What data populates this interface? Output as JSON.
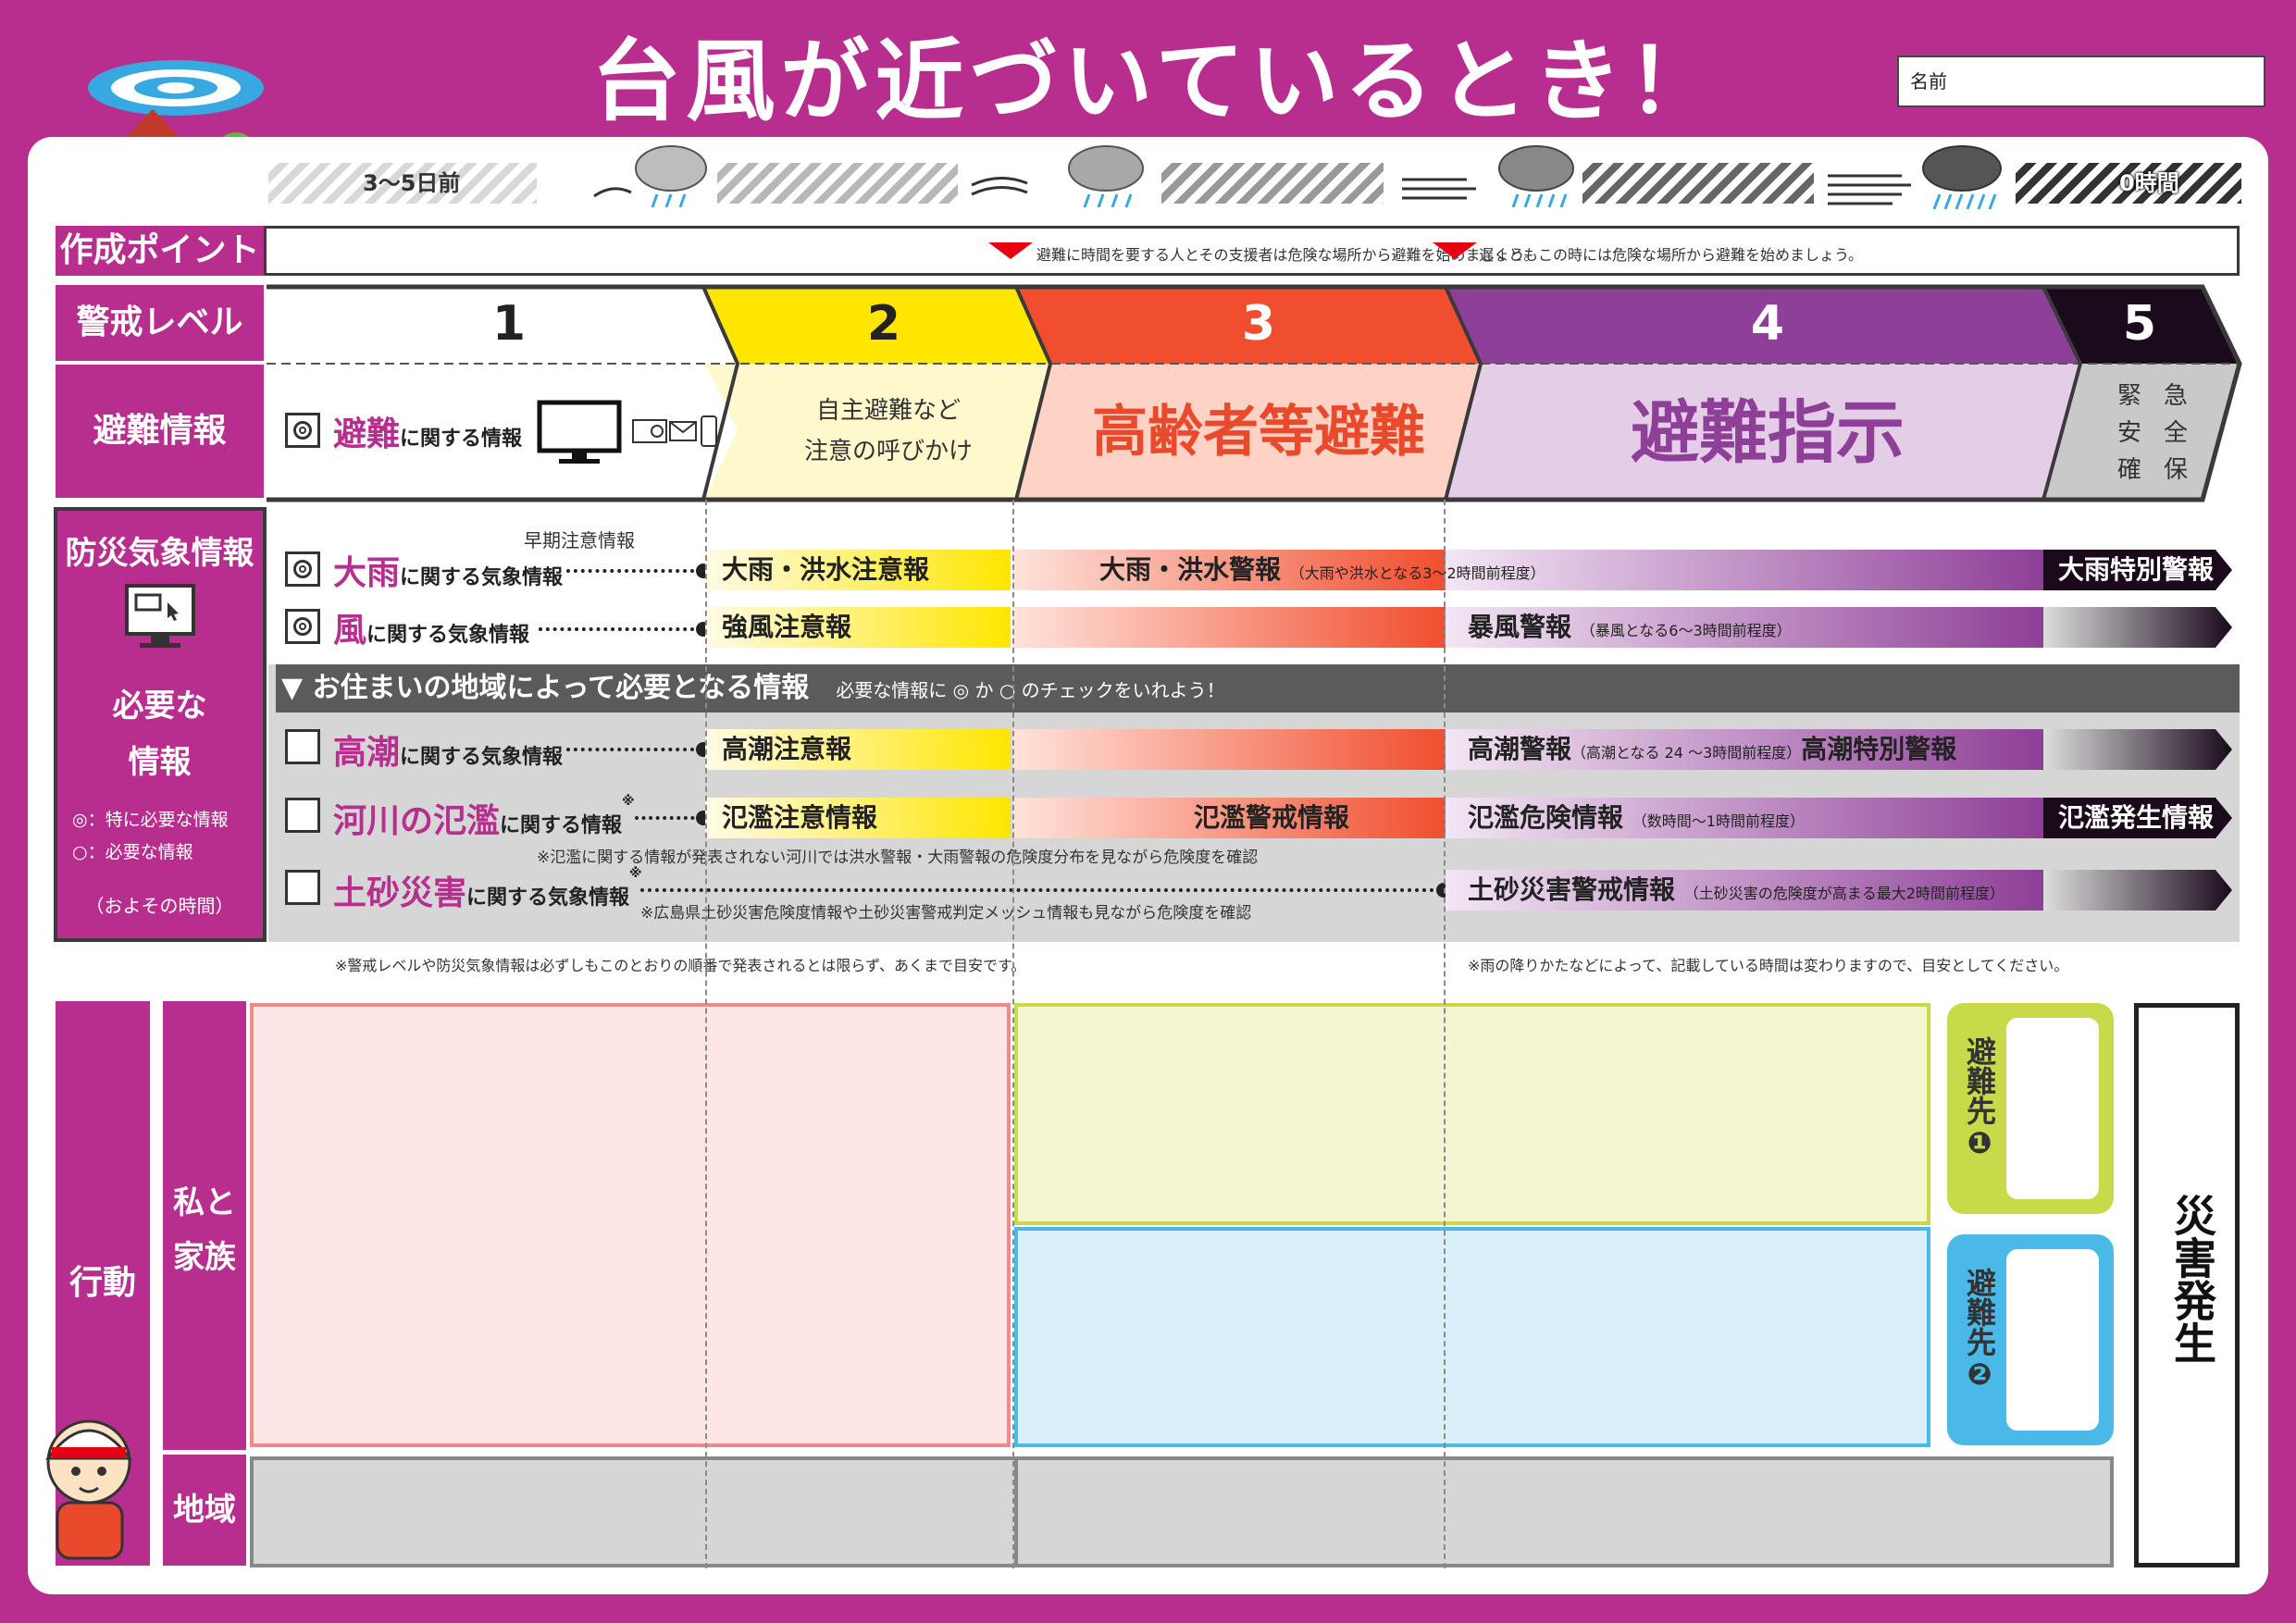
{
  "title": "台風が近づいているとき！",
  "name_label": "名前",
  "timeline": {
    "start": "3〜5日前",
    "end": "0時間"
  },
  "point_label": "作成ポイント",
  "point_notes": [
    "避難に時間を要する人とその支援者は危険な場所から避難を始めましょう。",
    "遅くともこの時には危険な場所から避難を始めましょう。"
  ],
  "alert_label": "警戒レベル",
  "levels": [
    "1",
    "2",
    "3",
    "4",
    "5"
  ],
  "evac_label": "避難情報",
  "evac_info": {
    "source_pre": "避難",
    "source_post": "に関する情報",
    "l2_line1": "自主避難など",
    "l2_line2": "注意の呼びかけ",
    "l3": "高齢者等避難",
    "l4": "避難指示",
    "l5": [
      "緊",
      "急",
      "安",
      "全",
      "確",
      "保"
    ]
  },
  "weather_label": "防災気象情報",
  "needed_label_1": "必要な",
  "needed_label_2": "情報",
  "legend_special": "：特に必要な情報",
  "legend_normal": "：必要な情報",
  "approx_time": "（およその時間）",
  "early_caution": "早期注意情報",
  "rows": {
    "rain": {
      "hl": "大雨",
      "label": "に関する気象情報",
      "caution": "大雨・洪水注意報",
      "warning": "大雨・洪水警報",
      "warning_note": "（大雨や洪水となる3〜2時間前程度）",
      "special": "大雨特別警報"
    },
    "wind": {
      "hl": "風",
      "label": "に関する気象情報",
      "caution": "強風注意報",
      "warning": "暴風警報",
      "warning_note": "（暴風となる6〜3時間前程度）"
    },
    "tide": {
      "hl": "高潮",
      "label": "に関する気象情報",
      "caution": "高潮注意報",
      "warning": "高潮警報",
      "warning_note": "（高潮となる 24 〜3時間前程度）",
      "special": "高潮特別警報"
    },
    "river": {
      "hl": "河川の氾濫",
      "label": "に関する情報",
      "mark": "※",
      "caution": "氾濫注意情報",
      "alert": "氾濫警戒情報",
      "danger": "氾濫危険情報",
      "danger_note": "（数時間〜1時間前程度）",
      "occur": "氾濫発生情報",
      "note": "※氾濫に関する情報が発表されない河川では洪水警報・大雨警報の危険度分布を見ながら危険度を確認"
    },
    "landslide": {
      "hl": "土砂災害",
      "label": "に関する気象情報",
      "mark": "※",
      "warning": "土砂災害警戒情報",
      "warning_note": "（土砂災害の危険度が高まる最大2時間前程度）",
      "note": "※広島県土砂災害危険度情報や土砂災害警戒判定メッシュ情報も見ながら危険度を確認"
    }
  },
  "area_bar": {
    "title": "▼ お住まいの地域によって必要となる情報",
    "hint_pre": "必要な情報に",
    "hint_mid": "か",
    "hint_post": "のチェックをいれよう！"
  },
  "footnote_left": "※警戒レベルや防災気象情報は必ずしもこのとおりの順番で発表されるとは限らず、あくまで目安です。",
  "footnote_right": "※雨の降りかたなどによって、記載している時間は変わりますので、目安としてください。",
  "action_label": "行動",
  "family_label_1": "私と",
  "family_label_2": "家族",
  "area_label": "地域",
  "shelter1": "避難先❶",
  "shelter2": "避難先❷",
  "disaster": "災害発生",
  "colors": {
    "magenta": "#b82e8f",
    "level2": "#ffe600",
    "level3": "#f04e2e",
    "level4": "#8e3f97",
    "level5": "#1a0a1c"
  }
}
